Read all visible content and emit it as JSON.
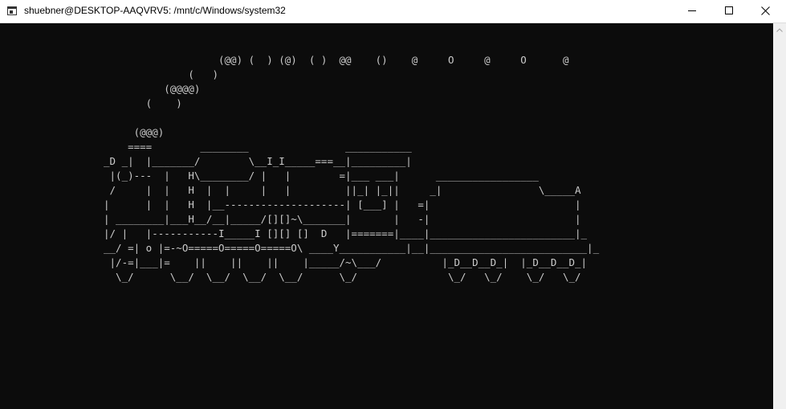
{
  "window": {
    "title": "shuebner@DESKTOP-AAQVRV5: /mnt/c/Windows/system32",
    "icons": {
      "app": "terminal-icon",
      "minimize": "minimize-icon",
      "maximize": "maximize-icon",
      "close": "close-icon"
    }
  },
  "terminal": {
    "ascii_art": "                   (@@) (  ) (@)  ( )  @@    ()    @     O     @     O      @\n              (   )\n          (@@@@)\n       (    )\n\n     (@@@)\n    ====        ________                ___________\n_D _|  |_______/        \\__I_I_____===__|_________|\n |(_)---  |   H\\________/ |   |        =|___ ___|      _________________\n /     |  |   H  |  |     |   |         ||_| |_||     _|                \\_____A\n|      |  |   H  |__--------------------| [___] |   =|                        |\n| ________|___H__/__|_____/[][]~\\_______|       |   -|                        |\n|/ |   |-----------I_____I [][] []  D   |=======|____|________________________|_\n__/ =| o |=-~O=====O=====O=====O\\ ____Y___________|__|__________________________|_\n |/-=|___|=    ||    ||    ||    |_____/~\\___/          |_D__D__D_|  |_D__D__D_|\n  \\_/      \\__/  \\__/  \\__/  \\__/      \\_/               \\_/   \\_/    \\_/   \\_/"
  },
  "colors": {
    "terminal_bg": "#0c0c0c",
    "terminal_fg": "#cccccc",
    "titlebar_bg": "#ffffff",
    "scrollbar_bg": "#f0f0f0"
  }
}
